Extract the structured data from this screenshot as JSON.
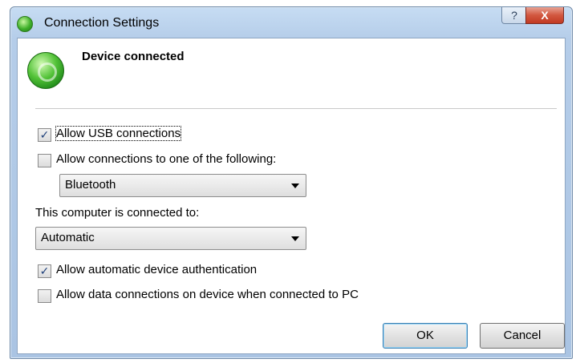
{
  "window": {
    "title": "Connection Settings",
    "help_glyph": "?",
    "close_glyph": "X",
    "app_icon": "green-connection-icon"
  },
  "header": {
    "status_text": "Device connected",
    "status_icon": "green-connected-orb-icon"
  },
  "options": {
    "allow_usb": {
      "label": "Allow USB connections",
      "checked": true
    },
    "allow_other": {
      "label": "Allow connections to one of the following:",
      "checked": false
    },
    "other_select": {
      "value": "Bluetooth"
    },
    "connected_to_label": "This computer is connected to:",
    "connected_to_select": {
      "value": "Automatic"
    },
    "auto_auth": {
      "label": "Allow automatic device authentication",
      "checked": true
    },
    "data_conn": {
      "label": "Allow data connections on device when connected to PC",
      "checked": false
    }
  },
  "buttons": {
    "ok": "OK",
    "cancel": "Cancel"
  },
  "colors": {
    "titlebar": "#b5cde9",
    "close_button": "#c13a21",
    "default_button_border": "#3c7fb1",
    "status_green": "#3fb02a"
  }
}
